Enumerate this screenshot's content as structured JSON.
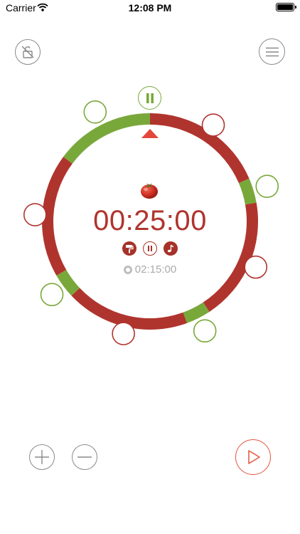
{
  "status_bar": {
    "carrier": "Carrier",
    "time": "12:08 PM"
  },
  "timer": {
    "current": "00:25:00",
    "total": "02:15:00",
    "segments": [
      {
        "phase": "work",
        "minutes": 25
      },
      {
        "phase": "break",
        "minutes": 5
      },
      {
        "phase": "work",
        "minutes": 25
      },
      {
        "phase": "break",
        "minutes": 5
      },
      {
        "phase": "work",
        "minutes": 25
      },
      {
        "phase": "break",
        "minutes": 5
      },
      {
        "phase": "work",
        "minutes": 25
      },
      {
        "phase": "break",
        "minutes": 20
      }
    ]
  },
  "icons": {
    "lock": "lock-open-icon",
    "menu": "hamburger-icon",
    "pause": "pause-icon",
    "tomato": "tomato-icon",
    "mini": [
      "paint-roller-icon",
      "ticking-icon",
      "music-note-icon"
    ],
    "add": "plus-icon",
    "remove": "minus-icon",
    "play": "play-icon"
  },
  "colors": {
    "work": "#b0342e",
    "break": "#79a83a",
    "pointer": "#e4473a",
    "play": "#e4553e",
    "gray": "#8a8a8a"
  }
}
